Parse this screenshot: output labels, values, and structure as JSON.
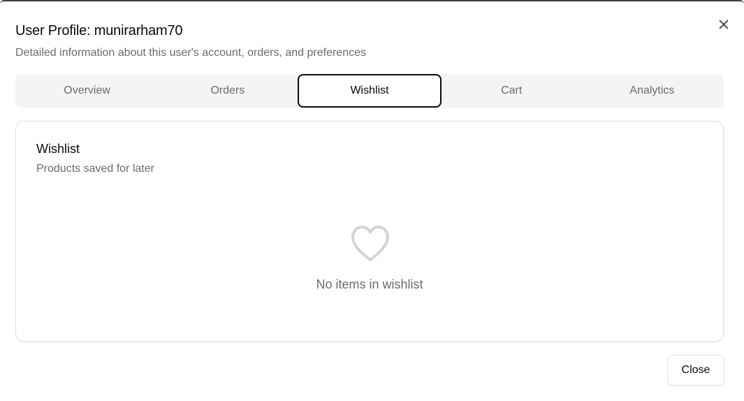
{
  "dialog": {
    "title": "User Profile: munirarham70",
    "subtitle": "Detailed information about this user's account, orders, and preferences",
    "close_icon": "close-icon"
  },
  "tabs": [
    {
      "label": "Overview",
      "active": false
    },
    {
      "label": "Orders",
      "active": false
    },
    {
      "label": "Wishlist",
      "active": true
    },
    {
      "label": "Cart",
      "active": false
    },
    {
      "label": "Analytics",
      "active": false
    }
  ],
  "wishlist": {
    "title": "Wishlist",
    "subtitle": "Products saved for later",
    "empty_icon": "heart-icon",
    "empty_text": "No items in wishlist"
  },
  "footer": {
    "close_label": "Close"
  },
  "colors": {
    "muted_text": "#6b6b6b",
    "tab_bg": "#f4f4f3",
    "icon_gray": "#d4d4d4"
  }
}
